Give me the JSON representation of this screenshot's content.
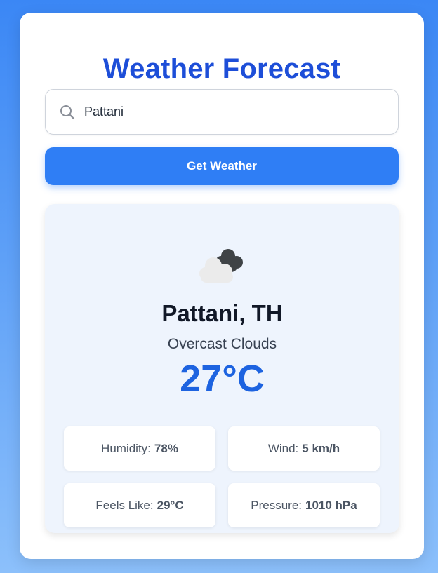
{
  "app": {
    "title": "Weather Forecast"
  },
  "search": {
    "value": "Pattani",
    "placeholder": "",
    "icon": "search-icon"
  },
  "button": {
    "label": "Get Weather",
    "color": "#2f7ef5"
  },
  "weather": {
    "icon": "overcast-clouds-icon",
    "location": "Pattani, TH",
    "description": "Overcast Clouds",
    "temperature": "27°C"
  },
  "details": [
    {
      "label": "Humidity:",
      "value": "78%"
    },
    {
      "label": "Wind:",
      "value": "5 km/h"
    },
    {
      "label": "Feels Like:",
      "value": "29°C"
    },
    {
      "label": "Pressure:",
      "value": "1010 hPa"
    }
  ],
  "colors": {
    "accent": "#1d4ed8",
    "temperature": "#1d63e0",
    "result_bg": "#eef4fd"
  }
}
